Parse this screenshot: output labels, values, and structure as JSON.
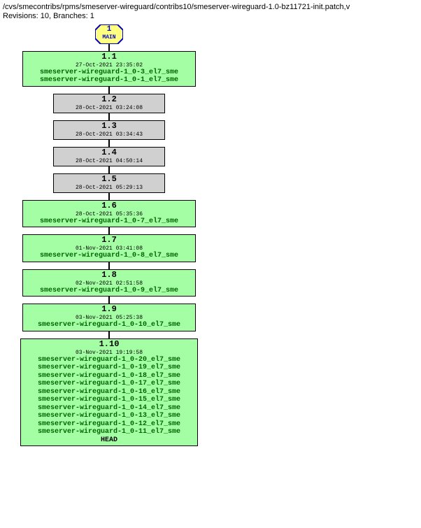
{
  "header": {
    "path": "/cvs/smecontribs/rpms/smeserver-wireguard/contribs10/smeserver-wireguard-1.0-bz11721-init.patch,v",
    "revisions_line": "Revisions: 10, Branches: 1"
  },
  "branch": {
    "number": "1",
    "name": "MAIN"
  },
  "revisions": [
    {
      "num": "1.1",
      "date": "27-Oct-2021 23:35:02",
      "bg": "green",
      "width": "med",
      "tags": [
        "smeserver-wireguard-1_0-3_el7_sme",
        "smeserver-wireguard-1_0-1_el7_sme"
      ],
      "head": ""
    },
    {
      "num": "1.2",
      "date": "28-Oct-2021 03:24:08",
      "bg": "grey",
      "width": "small",
      "tags": [],
      "head": ""
    },
    {
      "num": "1.3",
      "date": "28-Oct-2021 03:34:43",
      "bg": "grey",
      "width": "small",
      "tags": [],
      "head": ""
    },
    {
      "num": "1.4",
      "date": "28-Oct-2021 04:50:14",
      "bg": "grey",
      "width": "small",
      "tags": [],
      "head": ""
    },
    {
      "num": "1.5",
      "date": "28-Oct-2021 05:29:13",
      "bg": "grey",
      "width": "small",
      "tags": [],
      "head": ""
    },
    {
      "num": "1.6",
      "date": "28-Oct-2021 05:35:36",
      "bg": "green",
      "width": "med",
      "tags": [
        "smeserver-wireguard-1_0-7_el7_sme"
      ],
      "head": ""
    },
    {
      "num": "1.7",
      "date": "01-Nov-2021 03:41:08",
      "bg": "green",
      "width": "med",
      "tags": [
        "smeserver-wireguard-1_0-8_el7_sme"
      ],
      "head": ""
    },
    {
      "num": "1.8",
      "date": "02-Nov-2021 02:51:58",
      "bg": "green",
      "width": "med",
      "tags": [
        "smeserver-wireguard-1_0-9_el7_sme"
      ],
      "head": ""
    },
    {
      "num": "1.9",
      "date": "03-Nov-2021 05:25:38",
      "bg": "green",
      "width": "med",
      "tags": [
        "smeserver-wireguard-1_0-10_el7_sme"
      ],
      "head": ""
    },
    {
      "num": "1.10",
      "date": "03-Nov-2021 19:19:58",
      "bg": "green",
      "width": "large",
      "tags": [
        "smeserver-wireguard-1_0-20_el7_sme",
        "smeserver-wireguard-1_0-19_el7_sme",
        "smeserver-wireguard-1_0-18_el7_sme",
        "smeserver-wireguard-1_0-17_el7_sme",
        "smeserver-wireguard-1_0-16_el7_sme",
        "smeserver-wireguard-1_0-15_el7_sme",
        "smeserver-wireguard-1_0-14_el7_sme",
        "smeserver-wireguard-1_0-13_el7_sme",
        "smeserver-wireguard-1_0-12_el7_sme",
        "smeserver-wireguard-1_0-11_el7_sme"
      ],
      "head": "HEAD"
    }
  ]
}
